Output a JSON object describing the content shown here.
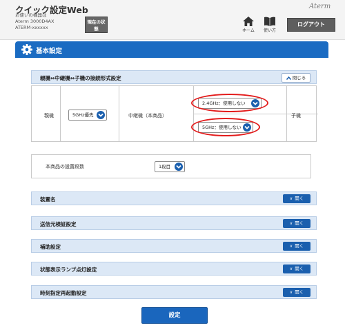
{
  "header": {
    "app_title": "クイック設定Web",
    "device_caption": "お使いの機器は",
    "device_model": "Aterm 3000D4AX",
    "device_name": "ATERM-xxxxxx",
    "status_button": "現在の状態",
    "home_label": "ホーム",
    "manual_label": "使い方",
    "logout_label": "ログアウト",
    "brand": "Aterm"
  },
  "section": {
    "title": "基本設定"
  },
  "connection_panel": {
    "title": "親機⇔中継機⇔子機の接続形式設定",
    "close_label": "閉じる",
    "parent_label": "親機",
    "parent_select": "5GHz優先",
    "relay_label": "中継機（本商品）",
    "relay_24_select": "2.4GHz：使用しない",
    "relay_5_select": "5GHz：使用しない",
    "child_label": "子機"
  },
  "level": {
    "label": "本商品の設置段数",
    "select": "1段目"
  },
  "panels": [
    {
      "title": "装置名",
      "button": "開く"
    },
    {
      "title": "送信元検証設定",
      "button": "開く"
    },
    {
      "title": "補助設定",
      "button": "開く"
    },
    {
      "title": "状態表示ランプ点灯設定",
      "button": "開く"
    },
    {
      "title": "時刻指定再起動設定",
      "button": "開く"
    }
  ],
  "apply_label": "設定",
  "colors": {
    "accent_blue": "#1a6bc2",
    "panel_header": "#dce8f6",
    "highlight_ring": "#e31c1c"
  }
}
